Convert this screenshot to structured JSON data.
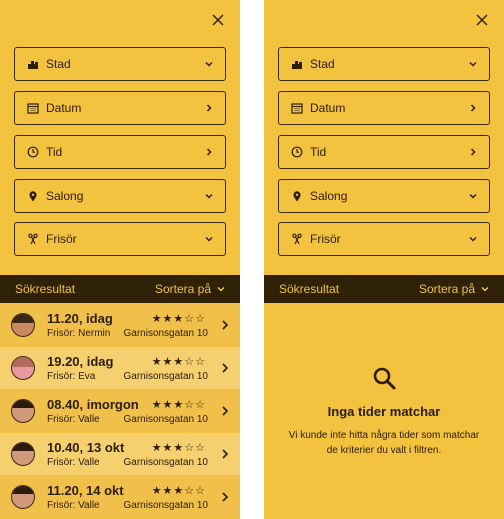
{
  "filters": [
    {
      "label": "Stad",
      "icon": "city-icon",
      "chevron": "down"
    },
    {
      "label": "Datum",
      "icon": "calendar-icon",
      "chevron": "right"
    },
    {
      "label": "Tid",
      "icon": "clock-icon",
      "chevron": "right"
    },
    {
      "label": "Salong",
      "icon": "location-pin-icon",
      "chevron": "down"
    },
    {
      "label": "Frisör",
      "icon": "scissors-icon",
      "chevron": "down"
    }
  ],
  "results_bar": {
    "title": "Sökresultat",
    "sort_label": "Sortera på"
  },
  "results": [
    {
      "when": "11.20, idag",
      "barber": "Frisör: Nermin",
      "address": "Garnisonsgatan 10",
      "stars": "★★★☆☆",
      "rating": 3
    },
    {
      "when": "19.20, idag",
      "barber": "Frisör: Eva",
      "address": "Garnisonsgatan 10",
      "stars": "★★★☆☆",
      "rating": 3
    },
    {
      "when": "08.40, imorgon",
      "barber": "Frisör: Valle",
      "address": "Garnisonsgatan 10",
      "stars": "★★★☆☆",
      "rating": 3
    },
    {
      "when": "10.40, 13 okt",
      "barber": "Frisör: Valle",
      "address": "Garnisonsgatan 10",
      "stars": "★★★☆☆",
      "rating": 3
    },
    {
      "when": "11.20, 14 okt",
      "barber": "Frisör: Valle",
      "address": "Garnisonsgatan 10",
      "stars": "★★★☆☆",
      "rating": 3
    }
  ],
  "empty_state": {
    "title": "Inga tider matchar",
    "message": "Vi kunde inte hitta några tider som matchar de kriterier du valt i filtren.",
    "icon": "search-icon"
  },
  "colors": {
    "background": "#f3c23f",
    "dark": "#2f2209",
    "row_alt": "#f6cf6f"
  }
}
